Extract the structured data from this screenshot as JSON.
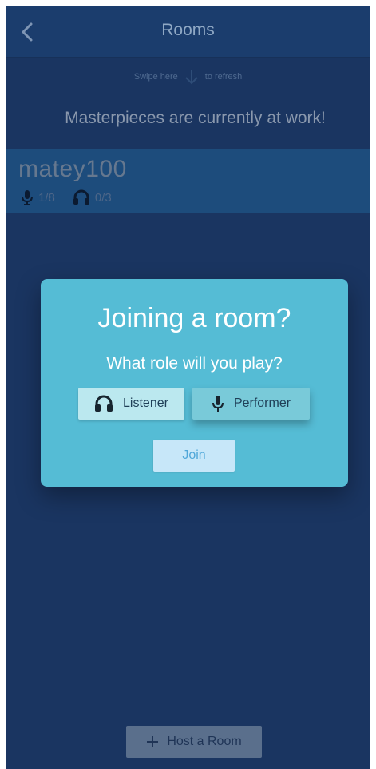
{
  "navbar": {
    "title": "Rooms",
    "back_icon": "chevron-left-icon"
  },
  "swipe": {
    "before": "Swipe here",
    "after": "to refresh",
    "icon": "arrow-down-icon"
  },
  "headline": "Masterpieces are currently at work!",
  "rooms": [
    {
      "name": "matey100",
      "performers": "1/8",
      "listeners": "0/3"
    }
  ],
  "host_button": {
    "label": "Host a Room",
    "icon": "plus-icon"
  },
  "dialog": {
    "title": "Joining a room?",
    "question": "What role will you play?",
    "roles": [
      {
        "label": "Listener",
        "icon": "headphones-icon",
        "selected": true
      },
      {
        "label": "Performer",
        "icon": "microphone-icon",
        "selected": false
      }
    ],
    "join_label": "Join"
  },
  "colors": {
    "background": "#1a3561",
    "dialog": "#55bcd5",
    "listener_button": "#bbe8ef",
    "performer_button": "#79cad9",
    "join_button": "#c7e7f9"
  }
}
